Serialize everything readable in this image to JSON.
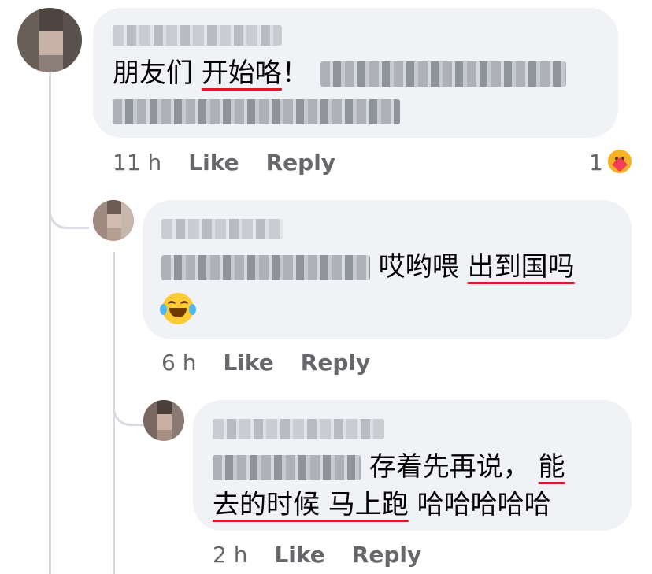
{
  "comments": [
    {
      "author_hidden": true,
      "text_parts": [
        {
          "t": "朋友们 ",
          "u": false
        },
        {
          "t": "开始咯",
          "u": true
        },
        {
          "t": "！",
          "u": false
        }
      ],
      "tagged_hidden": true,
      "time": "11 h",
      "like_label": "Like",
      "reply_label": "Reply",
      "reaction_count": "1",
      "reaction_icon": "care-reaction-icon"
    },
    {
      "author_hidden": true,
      "text_parts": [
        {
          "t": " 哎哟喂 ",
          "u": false
        },
        {
          "t": "出到国吗",
          "u": true
        }
      ],
      "emoji": "face-with-tears-of-joy-icon",
      "time": "6 h",
      "like_label": "Like",
      "reply_label": "Reply"
    },
    {
      "author_hidden": true,
      "line1": [
        {
          "t": " 存着先再说， ",
          "u": false
        },
        {
          "t": "能",
          "u": true
        }
      ],
      "line2": [
        {
          "t": "去的时候 马上跑",
          "u": true
        },
        {
          "t": " 哈哈哈哈哈",
          "u": false
        }
      ],
      "time": "2 h",
      "like_label": "Like",
      "reply_label": "Reply"
    }
  ],
  "colors": {
    "bubble": "#f0f2f5",
    "meta_text": "#65676b",
    "spell_underline": "#d21f2b"
  }
}
